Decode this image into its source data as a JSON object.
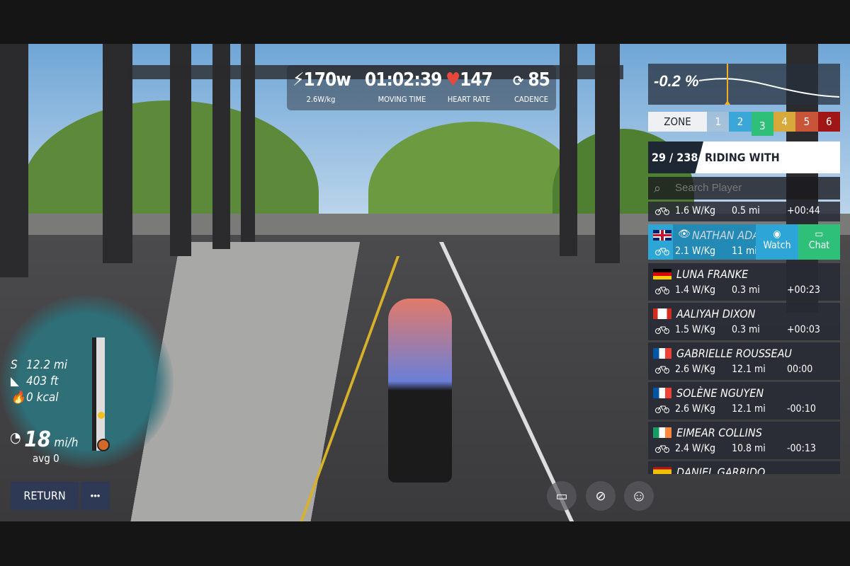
{
  "hud": {
    "power": "170w",
    "wkg": "2.6W/kg",
    "time": "01:02:39",
    "time_label": "MOVING TIME",
    "hr": "147",
    "hr_label": "HEART RATE",
    "cadence": "85",
    "cadence_label": "CADENCE"
  },
  "grade": "-0.2 %",
  "zone": {
    "label": "ZONE",
    "levels": [
      "1",
      "2",
      "3",
      "4",
      "5",
      "6"
    ],
    "active": "3",
    "colors": [
      "#c8ccd2",
      "#3aa7d8",
      "#2ebf78",
      "#d6a93a",
      "#c8553a",
      "#a01515"
    ]
  },
  "riding": {
    "position": "29 / 238",
    "title": "RIDING WITH"
  },
  "search": {
    "placeholder": "Search Player"
  },
  "riders": [
    {
      "name": "",
      "flag": "",
      "wkg": "1.6 W/Kg",
      "dist": "0.5 mi",
      "gap": "+00:44"
    },
    {
      "name": "NATHAN ADAM",
      "flag": "gb",
      "wkg": "2.1 W/Kg",
      "dist": "11 mi",
      "gap": "",
      "watch": "Watch",
      "chat": "Chat"
    },
    {
      "name": "LUNA FRANKE",
      "flag": "de",
      "wkg": "1.4 W/Kg",
      "dist": "0.3 mi",
      "gap": "+00:23"
    },
    {
      "name": "AALIYAH DIXON",
      "flag": "ca",
      "wkg": "1.5 W/Kg",
      "dist": "0.3 mi",
      "gap": "+00:03"
    },
    {
      "name": "GABRIELLE ROUSSEAU",
      "flag": "fr",
      "wkg": "2.6 W/Kg",
      "dist": "12.1 mi",
      "gap": "00:00"
    },
    {
      "name": "SOLÈNE NGUYEN",
      "flag": "fr",
      "wkg": "2.6 W/Kg",
      "dist": "12.1 mi",
      "gap": "-00:10"
    },
    {
      "name": "EIMEAR COLLINS",
      "flag": "ie",
      "wkg": "2.4 W/Kg",
      "dist": "10.8 mi",
      "gap": "-00:13"
    },
    {
      "name": "DANIEL GARRIDO",
      "flag": "es",
      "wkg": "",
      "dist": "",
      "gap": ""
    }
  ],
  "stats": {
    "distance": "12.2 mi",
    "elevation": "403 ft",
    "calories": "0 kcal",
    "speed": "18",
    "speed_unit": "mi/h",
    "avg": "avg 0"
  },
  "buttons": {
    "return": "RETURN",
    "more": "•••"
  }
}
